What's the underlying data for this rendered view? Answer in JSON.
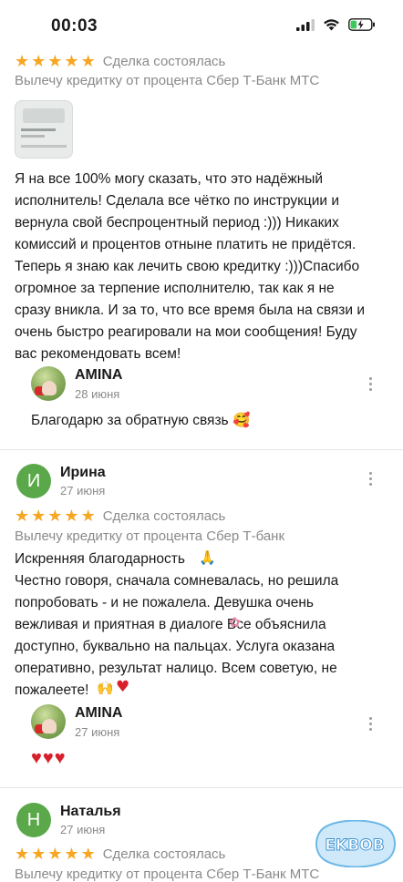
{
  "status": {
    "time": "00:03"
  },
  "review1": {
    "deal_status": "Сделка состоялась",
    "service": "Вылечу кредитку от процента Сбер Т-Банк МТС",
    "text": "Я на все 100% могу сказать, что это надёжный\nисполнитель! Сделала все чётко по инструкции и\nвернула свой беспроцентный период :))) Никаких\nкомиссий и процентов отныне платить не придётся.\nТеперь я знаю как лечить свою кредитку :)))Спасибо\nогромное за терпение исполнителю, так как я не\nсразу вникла. И за то, что все время была на связи и\nочень быстро реагировали на мои сообщения! Буду\nвас рекомендовать всем!",
    "reply": {
      "name": "AMINA",
      "date": "28 июня",
      "text": "Благодарю за обратную связь"
    }
  },
  "review2": {
    "avatar_letter": "И",
    "name": "Ирина",
    "date": "27 июня",
    "deal_status": "Сделка состоялась",
    "service": "Вылечу кредитку от процента Сбер Т-банк",
    "text": "Искренняя благодарность\nЧестно говоря, сначала сомневалась, но решила\nпопробовать - и не пожалела. Девушка очень\nвежливая и приятная в диалоге Все объяснила\nдоступно, буквально на пальцах. Услуга оказана\nоперативно, результат налицо. Всем советую, не\nпожалеете!",
    "reply": {
      "name": "AMINA",
      "date": "27 июня",
      "text": "♥♥♥"
    }
  },
  "review3": {
    "avatar_letter": "Н",
    "name": "Наталья",
    "date": "27 июня",
    "deal_status": "Сделка состоялась",
    "service": "Вылечу кредитку от процента Сбер Т-Банк МТС"
  },
  "watermark": {
    "text": "EKBOB"
  },
  "colors": {
    "star": "#f6a623",
    "avatar_green": "#5aa84a",
    "muted_text": "#8a8a8a"
  }
}
